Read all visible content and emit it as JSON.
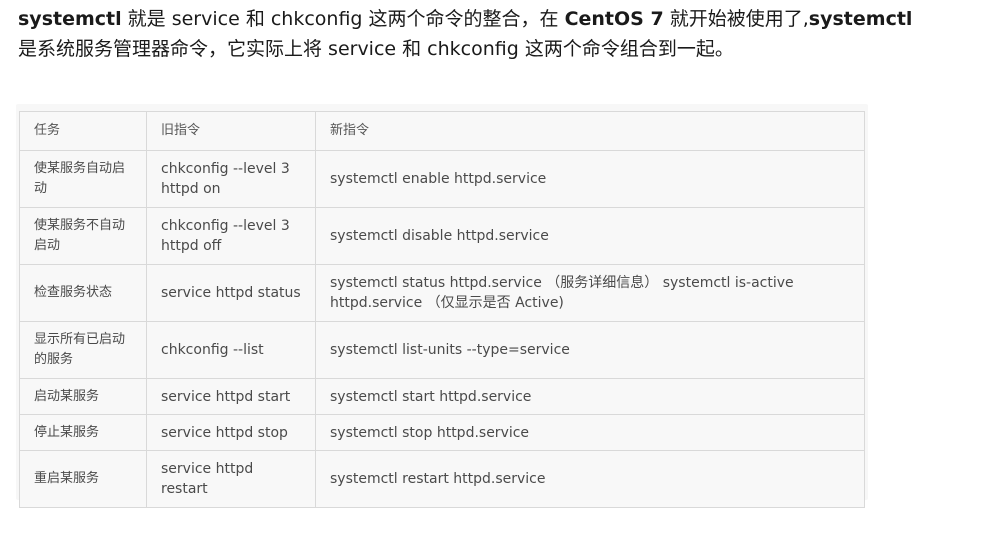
{
  "intro": {
    "line1_part1": "systemctl",
    "line1_part2": " 就是 service 和 chkconfig 这两个命令的整合，在 ",
    "line1_part3": "CentOS 7",
    "line1_part4": " 就开始被使用了,",
    "line1_part5": "systemctl",
    "line2": "是系统服务管理器命令，它实际上将  service  和  chkconfig  这两个命令组合到一起。"
  },
  "table": {
    "headers": [
      "任务",
      "旧指令",
      "新指令"
    ],
    "rows": [
      [
        "使某服务自动启动",
        "chkconfig --level 3 httpd on",
        "systemctl enable httpd.service"
      ],
      [
        "使某服务不自动启动",
        "chkconfig --level 3 httpd off",
        "systemctl disable httpd.service"
      ],
      [
        "检查服务状态",
        "service httpd status",
        "systemctl status httpd.service （服务详细信息） systemctl is-active httpd.service （仅显示是否 Active)"
      ],
      [
        "显示所有已启动的服务",
        "chkconfig --list",
        "systemctl list-units --type=service"
      ],
      [
        "启动某服务",
        "service httpd start",
        "systemctl start httpd.service"
      ],
      [
        "停止某服务",
        "service httpd stop",
        "systemctl stop httpd.service"
      ],
      [
        "重启某服务",
        "service httpd restart",
        "systemctl restart httpd.service"
      ]
    ]
  }
}
